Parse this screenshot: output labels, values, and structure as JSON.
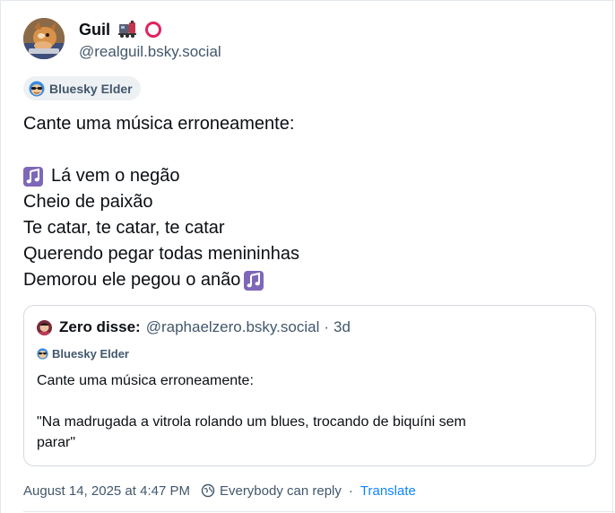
{
  "author": {
    "display_name": "Guil",
    "emoji_1": "train-emoji",
    "emoji_2": "red-ring-emoji",
    "handle": "@realguil.bsky.social",
    "avatar_icon": "avatar-dog-photo"
  },
  "badge": {
    "label": "Bluesky Elder",
    "icon": "sunglasses-butterfly-icon"
  },
  "post": {
    "line_1": "Cante uma música erroneamente:",
    "line_3": "Lá vem o negão",
    "line_4": "Cheio de paixão",
    "line_5": "Te catar, te catar, te catar",
    "line_6": "Querendo pegar todas menininhas",
    "line_7": "Demorou ele pegou o anão",
    "note_icon": "musical-notes-icon"
  },
  "quote": {
    "name": "Zero disse:",
    "handle": "@raphaelzero.bsky.social",
    "dot": "·",
    "time": "3d",
    "badge_label": "Bluesky Elder",
    "text_line_1": "Cante uma música erroneamente:",
    "text_line_3": "\"Na madrugada a vitrola rolando um blues, trocando de biquíni sem",
    "text_line_4": "parar\""
  },
  "footer": {
    "timestamp": "August 14, 2025 at 4:47 PM",
    "reply_setting": "Everybody can reply",
    "separator": "·",
    "translate_label": "Translate"
  },
  "colors": {
    "text": "#0b0f14",
    "muted": "#42576c",
    "link": "#1083fe",
    "border": "#d4dbe2",
    "note_purple": "#7e67b8"
  }
}
